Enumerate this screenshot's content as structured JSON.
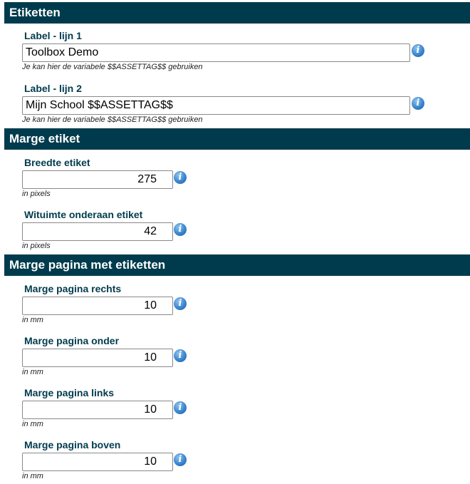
{
  "sections": {
    "labels": {
      "title": "Etiketten",
      "fields": [
        {
          "label": "Label - lijn 1",
          "value": "Toolbox Demo",
          "hint": "Je kan hier de variabele $$ASSETTAG$$ gebruiken"
        },
        {
          "label": "Label - lijn 2",
          "value": "Mijn School $$ASSETTAG$$",
          "hint": "Je kan hier de variabele $$ASSETTAG$$ gebruiken"
        }
      ]
    },
    "label_margin": {
      "title": "Marge etiket",
      "fields": [
        {
          "label": "Breedte etiket",
          "value": "275",
          "hint": "in pixels"
        },
        {
          "label": "Wituimte onderaan etiket",
          "value": "42",
          "hint": "in pixels"
        }
      ]
    },
    "page_margin": {
      "title": "Marge pagina met etiketten",
      "fields": [
        {
          "label": "Marge pagina rechts",
          "value": "10",
          "hint": "in mm"
        },
        {
          "label": "Marge pagina onder",
          "value": "10",
          "hint": "in mm"
        },
        {
          "label": "Marge pagina links",
          "value": "10",
          "hint": "in mm"
        },
        {
          "label": "Marge pagina boven",
          "value": "10",
          "hint": "in mm"
        }
      ]
    }
  },
  "icons": {
    "info": "info-icon"
  },
  "colors": {
    "header_bg": "#003b4d",
    "label_text": "#003b4d",
    "info_icon": "#3a86cf"
  },
  "info_glyph": "i"
}
